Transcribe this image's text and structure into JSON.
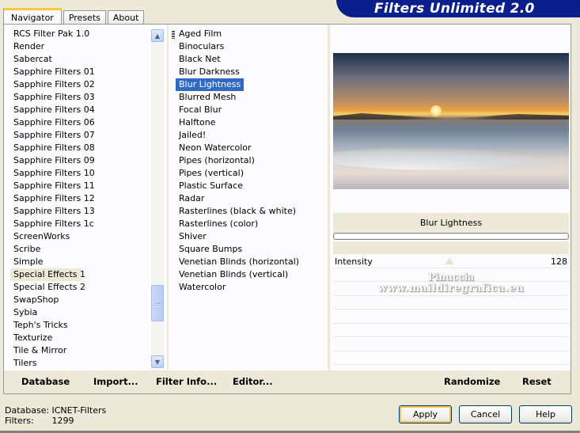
{
  "tabs": [
    {
      "label": "Navigator",
      "active": true
    },
    {
      "label": "Presets",
      "active": false
    },
    {
      "label": "About",
      "active": false
    }
  ],
  "title": "Filters Unlimited 2.0",
  "categories": [
    "RCS Filter Pak 1.0",
    "Render",
    "Sabercat",
    "Sapphire Filters 01",
    "Sapphire Filters 02",
    "Sapphire Filters 03",
    "Sapphire Filters 04",
    "Sapphire Filters 06",
    "Sapphire Filters 07",
    "Sapphire Filters 08",
    "Sapphire Filters 09",
    "Sapphire Filters 10",
    "Sapphire Filters 11",
    "Sapphire Filters 12",
    "Sapphire Filters 13",
    "Sapphire Filters 1c",
    "ScreenWorks",
    "Scribe",
    "Simple",
    "Special Effects 1",
    "Special Effects 2",
    "SwapShop",
    "Sybia",
    "Teph's Tricks",
    "Texturize",
    "Tile & Mirror",
    "Tilers"
  ],
  "selected_category": "Special Effects 1",
  "filters": [
    "Aged Film",
    "Binoculars",
    "Black Net",
    "Blur Darkness",
    "Blur Lightness",
    "Blurred Mesh",
    "Focal Blur",
    "Halftone",
    "Jailed!",
    "Neon Watercolor",
    "Pipes (horizontal)",
    "Pipes (vertical)",
    "Plastic Surface",
    "Radar",
    "Rasterlines (black & white)",
    "Rasterlines (color)",
    "Shiver",
    "Square Bumps",
    "Venetian Blinds (horizontal)",
    "Venetian Blinds (vertical)",
    "Watercolor"
  ],
  "selected_filter": "Blur Lightness",
  "preview": {
    "filter_name": "Blur Lightness",
    "progress": 0
  },
  "parameters": [
    {
      "label": "Intensity",
      "value": "128"
    }
  ],
  "watermark": {
    "line1": "Pinuccia",
    "line2": "www.maildiregrafica.eu"
  },
  "left_buttons": {
    "database": "Database",
    "import": "Import...",
    "filter_info": "Filter Info...",
    "editor": "Editor..."
  },
  "right_buttons": {
    "randomize": "Randomize",
    "reset": "Reset"
  },
  "status": {
    "database_label": "Database:",
    "database_value": "ICNET-Filters",
    "filters_label": "Filters:",
    "filters_value": "1299"
  },
  "dialog_buttons": {
    "apply": "Apply",
    "cancel": "Cancel",
    "help": "Help"
  },
  "colors": {
    "banner": "#0A1E8C",
    "selection": "#316AC5",
    "window_bg": "#ECE9D8"
  }
}
